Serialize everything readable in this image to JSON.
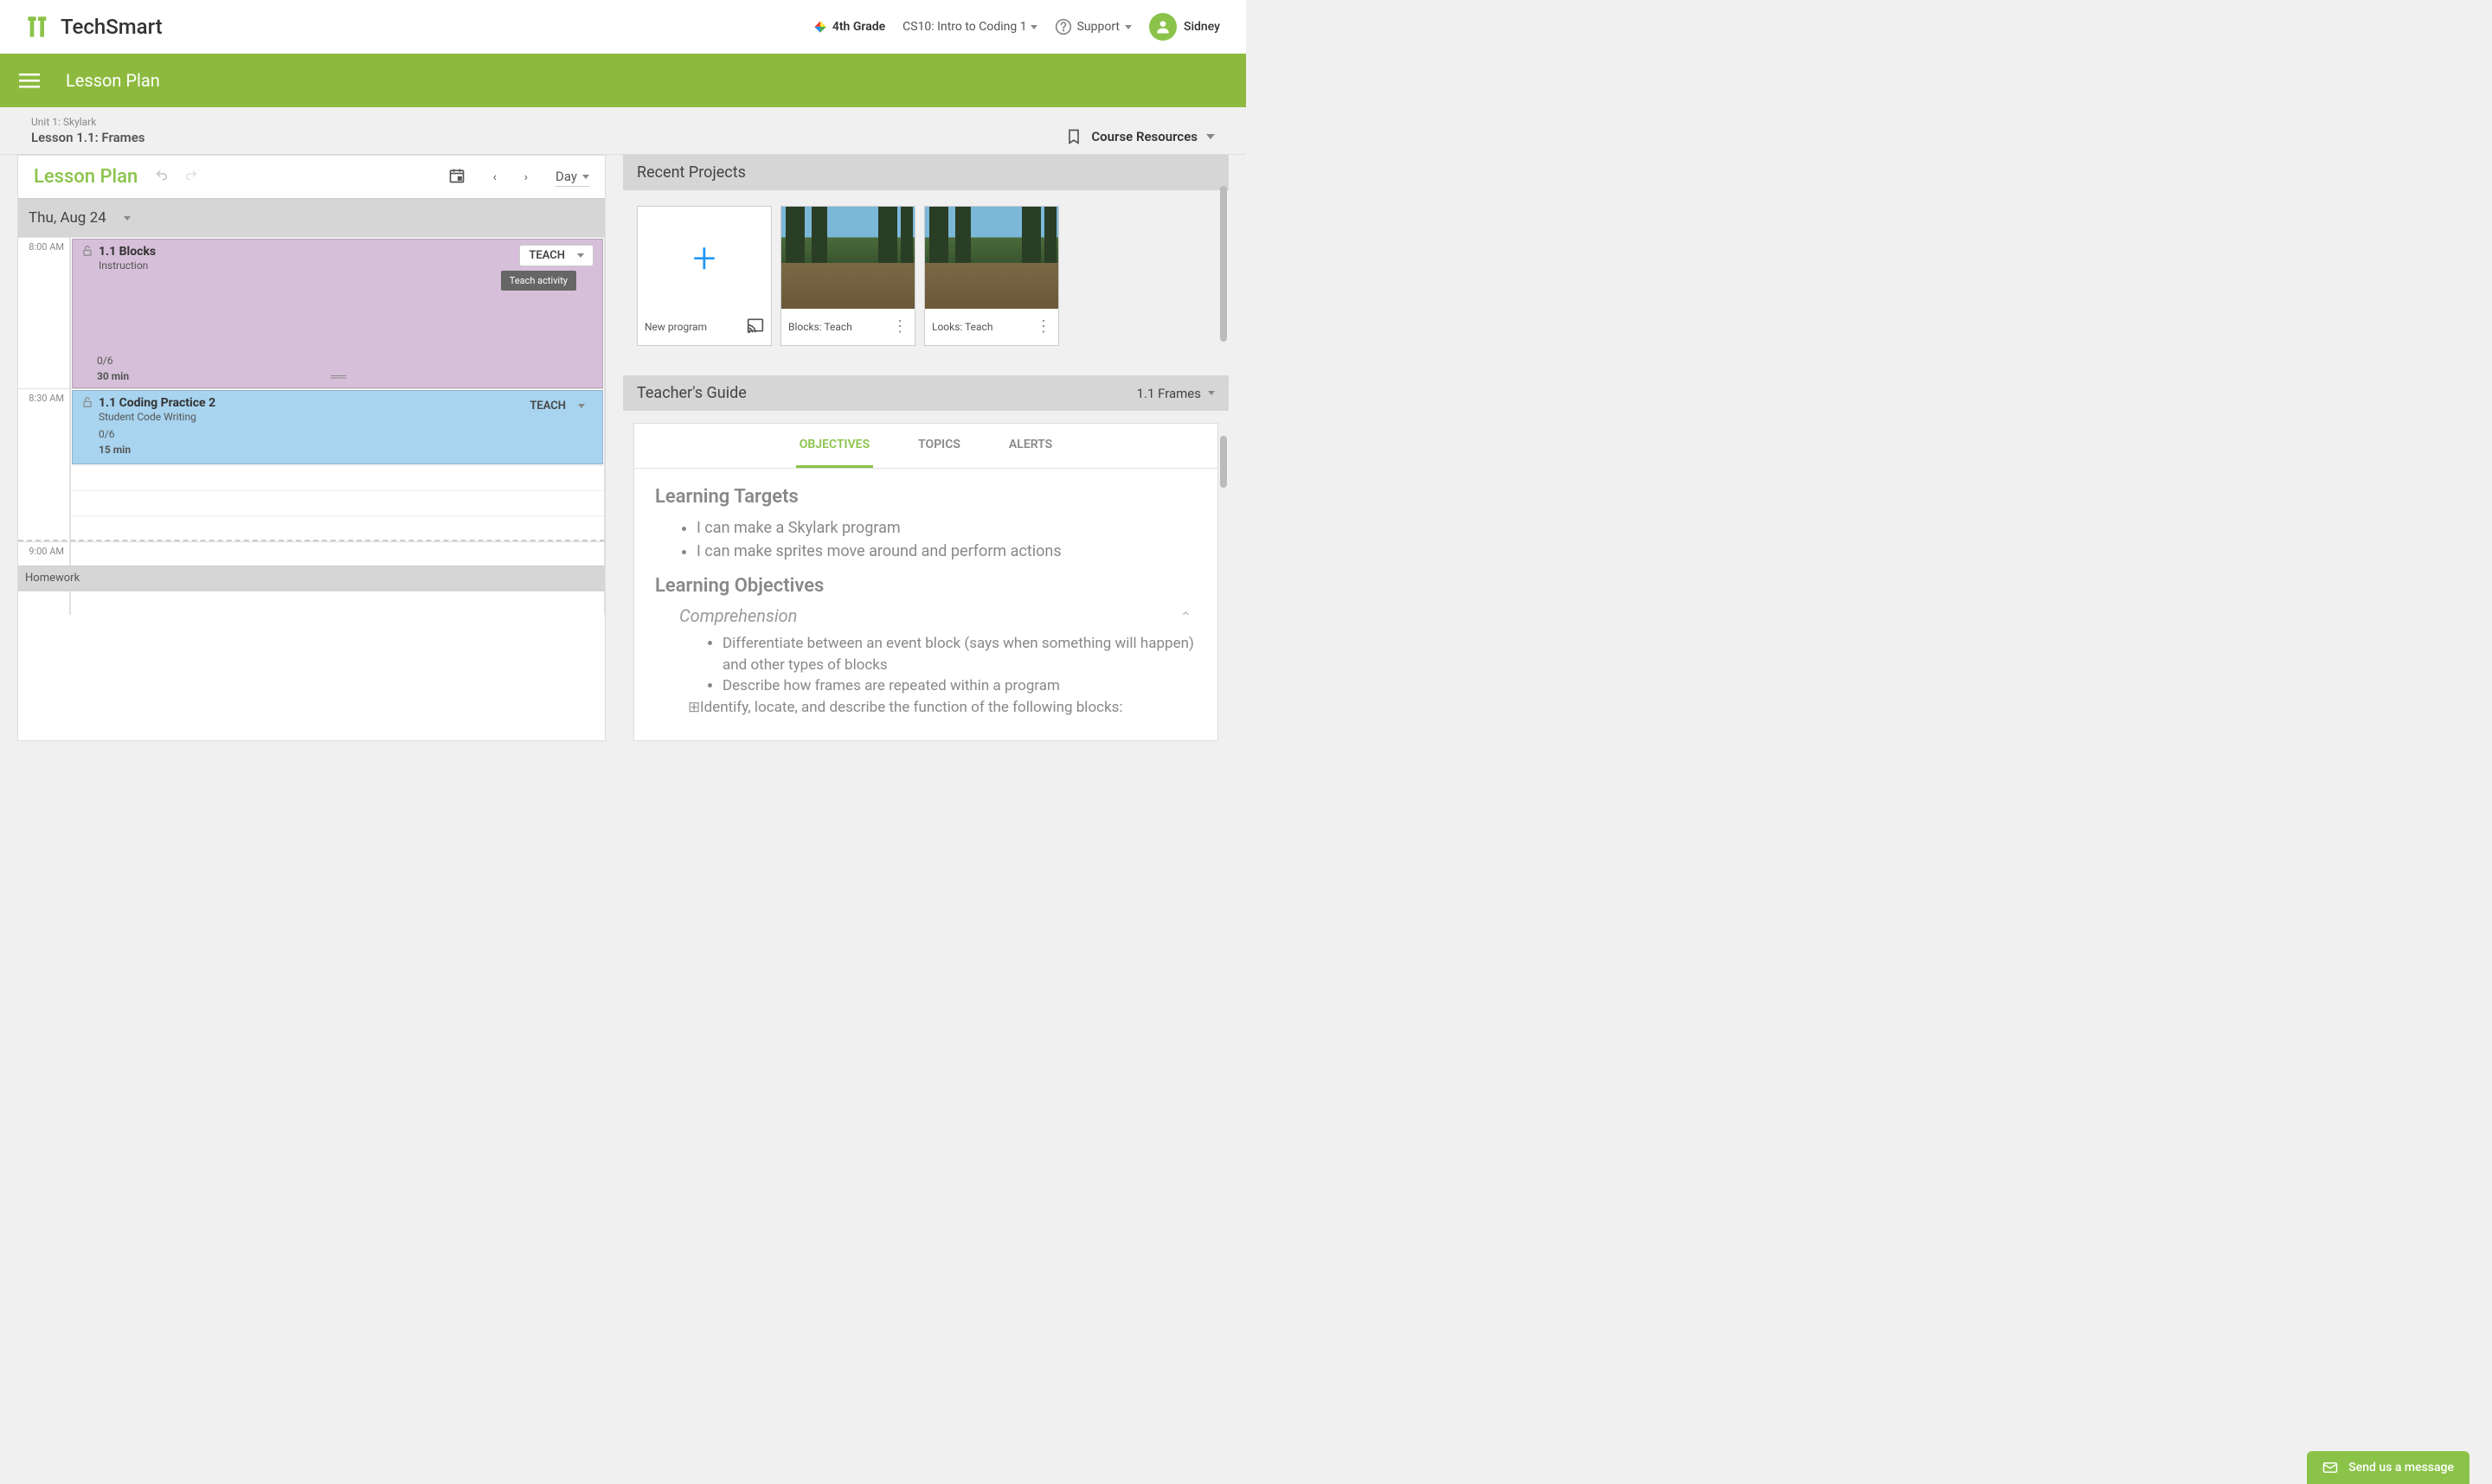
{
  "header": {
    "brand": "TechSmart",
    "grade": "4th Grade",
    "course": "CS10: Intro to Coding 1",
    "support": "Support",
    "user": "Sidney"
  },
  "subheader": {
    "title": "Lesson Plan"
  },
  "breadcrumb": {
    "unit": "Unit 1: Skylark",
    "lesson": "Lesson 1.1: Frames",
    "resources": "Course Resources"
  },
  "lessonPlan": {
    "title": "Lesson Plan",
    "view": "Day",
    "date": "Thu, Aug 24",
    "times": {
      "t800": "8:00 AM",
      "t830": "8:30 AM",
      "t900": "9:00 AM"
    },
    "events": [
      {
        "title": "1.1 Blocks",
        "subtitle": "Instruction",
        "progress": "0/6",
        "duration": "30 min",
        "teach": "TEACH",
        "tooltip": "Teach activity"
      },
      {
        "title": "1.1 Coding Practice 2",
        "subtitle": "Student Code Writing",
        "progress": "0/6",
        "duration": "15 min",
        "teach": "TEACH"
      }
    ],
    "homework": "Homework"
  },
  "recentProjects": {
    "title": "Recent Projects",
    "cards": [
      {
        "label": "New program"
      },
      {
        "label": "Blocks: Teach"
      },
      {
        "label": "Looks: Teach"
      }
    ]
  },
  "teachersGuide": {
    "title": "Teacher's Guide",
    "context": "1.1 Frames",
    "tabs": {
      "objectives": "OBJECTIVES",
      "topics": "TOPICS",
      "alerts": "ALERTS"
    },
    "content": {
      "h_targets": "Learning Targets",
      "targets": [
        "I can make a Skylark program",
        "I can make sprites move around and perform actions"
      ],
      "h_objectives": "Learning Objectives",
      "h_comp": "Comprehension",
      "comp": [
        "Differentiate between an event block (says when something will happen) and other types of blocks",
        "Describe how frames are repeated within a program"
      ],
      "comp_expand": "Identify, locate, and describe the function of the following blocks:"
    }
  },
  "chat": {
    "label": "Send us a message"
  }
}
